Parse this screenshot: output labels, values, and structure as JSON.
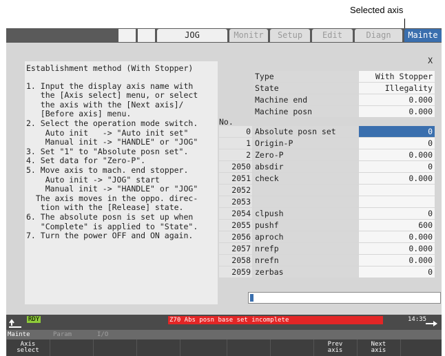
{
  "callout": {
    "label": "Selected axis"
  },
  "tabs": [
    {
      "label": "JOG"
    },
    {
      "label": "Monitr"
    },
    {
      "label": "Setup"
    },
    {
      "label": "Edit"
    },
    {
      "label": "Diagn"
    },
    {
      "label": "Mainte"
    }
  ],
  "panel": {
    "title": "Establishment method (With Stopper)",
    "steps": [
      "1. Input the display axis name with",
      "   the [Axis select] menu, or select",
      "   the axis with the [Next axis]/",
      "   [Before axis] menu.",
      "2. Select the operation mode switch.",
      "    Auto init   -> \"Auto init set\"",
      "    Manual init -> \"HANDLE\" or \"JOG\"",
      "3. Set \"1\" to \"Absolute posn set\".",
      "4. Set data for \"Zero-P\".",
      "5. Move axis to mach. end stopper.",
      "    Auto init -> \"JOG\" start",
      "    Manual init -> \"HANDLE\" or \"JOG\"",
      "  The axis moves in the oppo. direc-",
      "   tion with the [Release] state.",
      "6. The absolute posn is set up when",
      "   \"Complete\" is applied to \"State\".",
      "7. Turn the power OFF and ON again."
    ]
  },
  "axis": {
    "name": "X"
  },
  "info": [
    {
      "label": "Type",
      "value": "With Stopper"
    },
    {
      "label": "State",
      "value": "Illegality"
    },
    {
      "label": "Machine end",
      "value": "0.000"
    },
    {
      "label": "Machine posn",
      "value": "0.000"
    }
  ],
  "params_header": "No.",
  "params": [
    {
      "no": "0",
      "name": "Absolute posn set",
      "value": "0"
    },
    {
      "no": "1",
      "name": "Origin-P",
      "value": "0"
    },
    {
      "no": "2",
      "name": "Zero-P",
      "value": "0.000"
    },
    {
      "no": "2050",
      "name": "absdir",
      "value": "0"
    },
    {
      "no": "2051",
      "name": "check",
      "value": "0.000"
    },
    {
      "no": "2052",
      "name": "",
      "value": ""
    },
    {
      "no": "2053",
      "name": "",
      "value": ""
    },
    {
      "no": "2054",
      "name": "clpush",
      "value": "0"
    },
    {
      "no": "2055",
      "name": "pushf",
      "value": "600"
    },
    {
      "no": "2056",
      "name": "aproch",
      "value": "0.000"
    },
    {
      "no": "2057",
      "name": "nrefp",
      "value": "0.000"
    },
    {
      "no": "2058",
      "name": "nrefn",
      "value": "0.000"
    },
    {
      "no": "2059",
      "name": "zerbas",
      "value": "0"
    }
  ],
  "status": {
    "ready": "RDY",
    "alarm": "Z70  Abs posn base set incomplete",
    "time": "14:35"
  },
  "menu_path": [
    {
      "label": "Mainte"
    },
    {
      "label": "Param"
    },
    {
      "label": "I/O"
    }
  ],
  "softkeys": [
    {
      "line1": "Axis",
      "line2": "select"
    },
    {
      "line1": "",
      "line2": ""
    },
    {
      "line1": "",
      "line2": ""
    },
    {
      "line1": "",
      "line2": ""
    },
    {
      "line1": "",
      "line2": ""
    },
    {
      "line1": "",
      "line2": ""
    },
    {
      "line1": "",
      "line2": ""
    },
    {
      "line1": "Prev",
      "line2": "axis"
    },
    {
      "line1": "Next",
      "line2": "axis"
    },
    {
      "line1": "",
      "line2": ""
    }
  ]
}
